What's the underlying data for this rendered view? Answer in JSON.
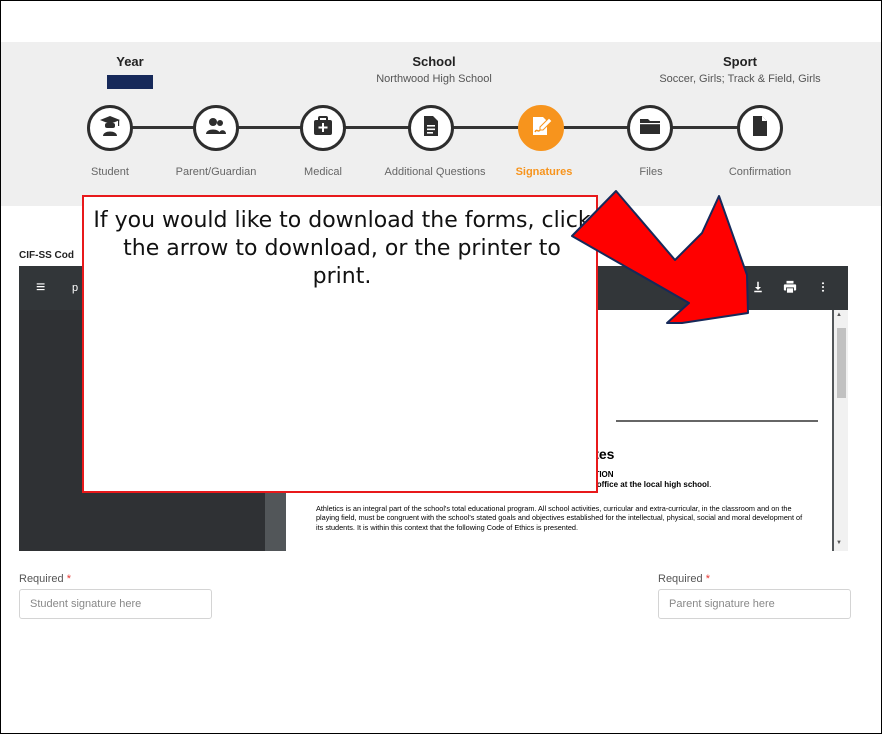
{
  "header": {
    "year": {
      "title": "Year",
      "value_color": "#16295a"
    },
    "school": {
      "title": "School",
      "value": "Northwood High School"
    },
    "sport": {
      "title": "Sport",
      "value": "Soccer, Girls; Track & Field, Girls"
    }
  },
  "steps": [
    {
      "label": "Student",
      "icon": "graduate-icon",
      "active": false
    },
    {
      "label": "Parent/Guardian",
      "icon": "people-icon",
      "active": false
    },
    {
      "label": "Medical",
      "icon": "medical-kit-icon",
      "active": false
    },
    {
      "label": "Additional Questions",
      "icon": "document-icon",
      "active": false
    },
    {
      "label": "Signatures",
      "icon": "signature-icon",
      "active": true
    },
    {
      "label": "Files",
      "icon": "folder-icon",
      "active": false
    },
    {
      "label": "Confirmation",
      "icon": "file-icon",
      "active": false
    }
  ],
  "colors": {
    "accent": "#f7941d",
    "callout_border": "#e8191b",
    "arrow": "#ff0000"
  },
  "document": {
    "title_fragment": "CIF-SS Cod",
    "viewer": {
      "filename_fragment": "p",
      "menu_icon": "menu-icon",
      "download_icon": "download-icon",
      "print_icon": "print-icon",
      "more_icon": "more-vert-icon"
    },
    "page": {
      "heading_fragment": "hletes",
      "section_line1_fragment": "N SECTION",
      "section_line2_fragment": "ctor's office at the local high school",
      "section_line2_end": ".",
      "tiny_fragment": "o",
      "paragraph": "Athletics is an integral part of the school's total educational program.  All school activities, curricular and extra-curricular, in the classroom and on the playing field, must be congruent with the school's stated goals and objectives established for the intellectual, physical, social and moral development of its students.  It is within this context that the following Code of Ethics is presented."
    }
  },
  "signatures": {
    "student": {
      "required_label": "Required",
      "required_mark": "*",
      "placeholder": "Student signature here"
    },
    "parent": {
      "required_label": "Required",
      "required_mark": "*",
      "placeholder": "Parent signature here"
    }
  },
  "callout": {
    "text": "If you would like to download the forms, click the arrow to download, or the printer to print."
  }
}
